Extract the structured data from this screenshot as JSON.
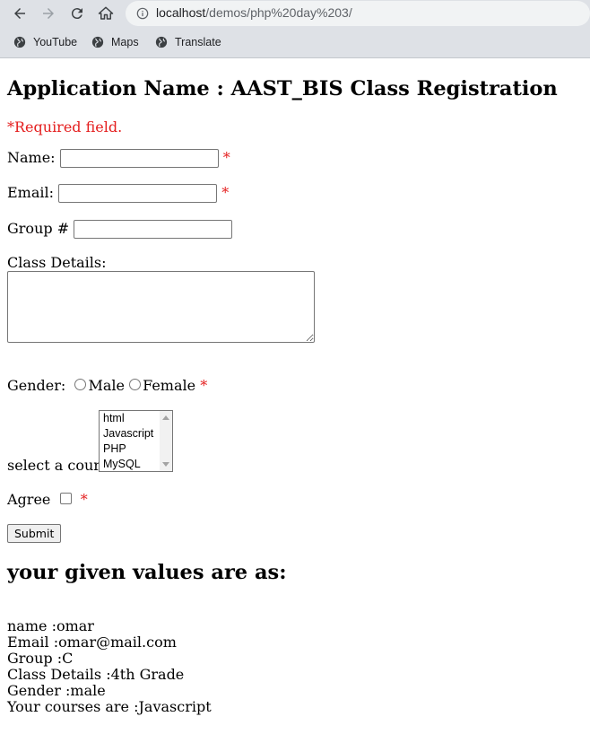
{
  "browser": {
    "url_host": "localhost",
    "url_path": "/demos/php%20day%203/",
    "bookmarks": [
      {
        "label": "YouTube",
        "icon": "globe-icon"
      },
      {
        "label": "Maps",
        "icon": "globe-icon"
      },
      {
        "label": "Translate",
        "icon": "globe-icon"
      }
    ]
  },
  "form": {
    "heading": "Application Name : AAST_BIS Class Registration",
    "required_note": "*Required field.",
    "name_label": "Name:",
    "email_label": "Email:",
    "group_label": "Group #",
    "class_details_label": "Class Details:",
    "gender_label": "Gender:",
    "gender_options": [
      "Male",
      "Female"
    ],
    "course_label": "select a course:",
    "courses": [
      "html",
      "Javascript",
      "PHP",
      "MySQL"
    ],
    "agree_label": "Agree",
    "required_mark": "*",
    "submit_label": "Submit"
  },
  "results": {
    "heading": "your given values are as:",
    "lines": [
      "name :omar",
      "Email :omar@mail.com",
      "Group :C",
      "Class Details :4th Grade",
      "Gender :male",
      "Your courses are :Javascript"
    ]
  },
  "colors": {
    "required": "#e41e1e",
    "chrome": "#dee1e6"
  }
}
